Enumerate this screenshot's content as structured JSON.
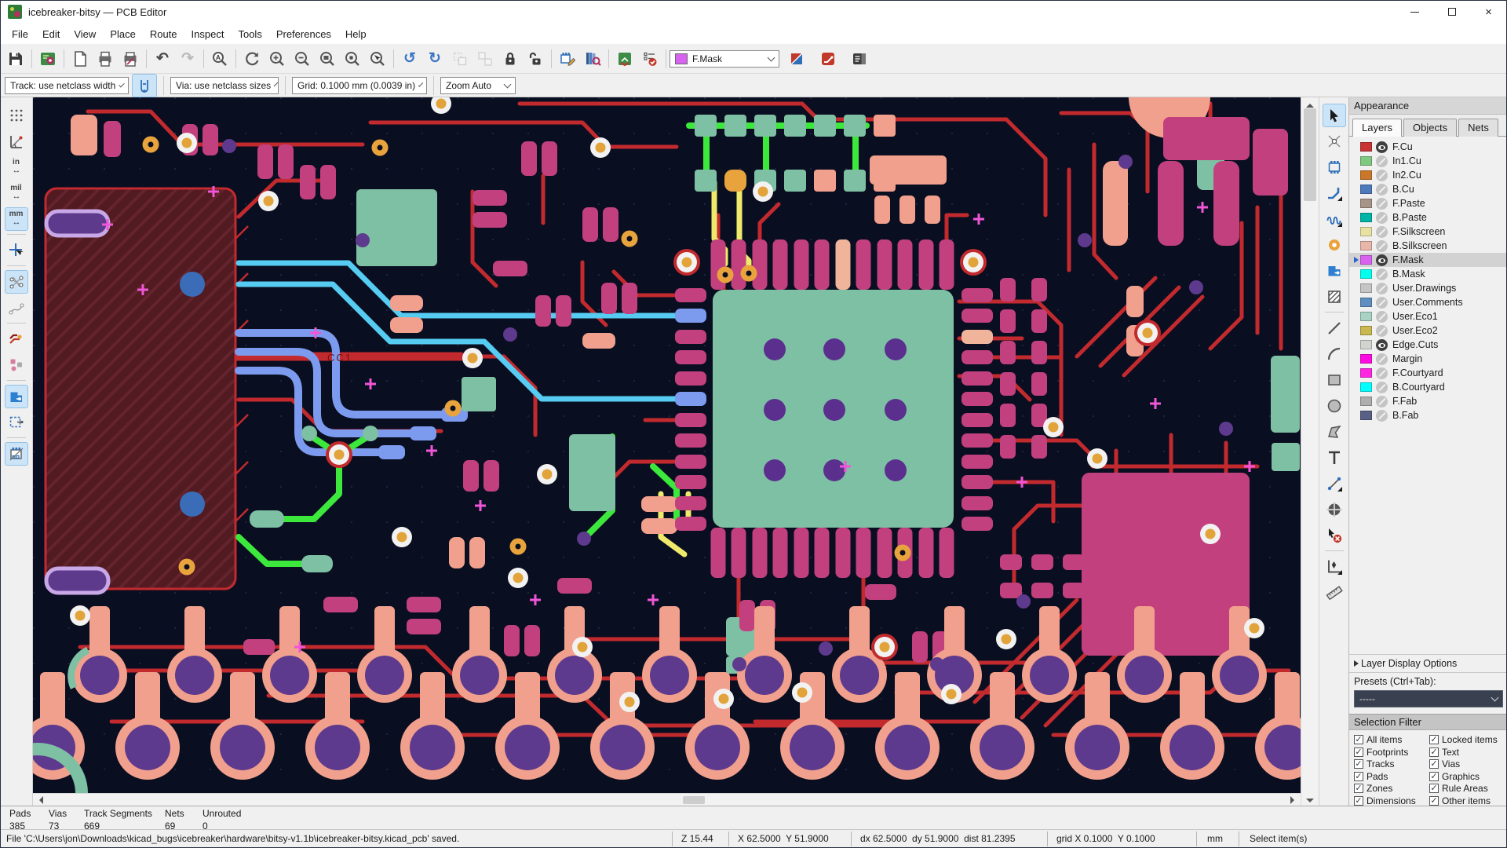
{
  "window": {
    "title": "icebreaker-bitsy — PCB Editor",
    "controls": [
      "minimize",
      "maximize",
      "close"
    ]
  },
  "menu": {
    "items": [
      "File",
      "Edit",
      "View",
      "Place",
      "Route",
      "Inspect",
      "Tools",
      "Preferences",
      "Help"
    ]
  },
  "toolbar": {
    "icons": [
      "save",
      "board-setup",
      "page-settings",
      "print",
      "plot",
      "undo",
      "redo",
      "find",
      "refresh-view",
      "zoom-in",
      "zoom-out",
      "zoom-fit",
      "zoom-objects",
      "zoom-selection",
      "rotate-ccw",
      "rotate-cw",
      "group",
      "ungroup",
      "lock",
      "unlock",
      "footprint-editor",
      "library-browser",
      "update-pcb",
      "design-rules-check",
      "layer-pair",
      "router-settings",
      "properties-panel"
    ],
    "active_layer": "F.Mask",
    "active_layer_color": "#d863f0"
  },
  "toolbar2": {
    "track": "Track: use netclass width",
    "via": "Via: use netclass sizes",
    "grid": "Grid: 0.1000 mm (0.0039 in)",
    "zoom": "Zoom Auto"
  },
  "left_toolbar": {
    "units_in": "in",
    "units_mil": "mil",
    "units_mm": "mm",
    "icons": [
      {
        "name": "toggle-grid",
        "active": false
      },
      {
        "name": "polar-coordinates",
        "active": false
      },
      {
        "name": "units-inches",
        "active": false
      },
      {
        "name": "units-mils",
        "active": false
      },
      {
        "name": "units-millimeters",
        "active": true
      },
      {
        "name": "crosshair-cursor",
        "active": false
      },
      {
        "name": "show-ratsnest",
        "active": true
      },
      {
        "name": "curved-ratsnest",
        "active": false
      },
      {
        "name": "track-display-mode",
        "active": false
      },
      {
        "name": "pad-display-mode",
        "active": false
      },
      {
        "name": "zone-display-mode",
        "active": true
      },
      {
        "name": "rule-area-display",
        "active": false
      },
      {
        "name": "footprint-display-mode",
        "active": true
      }
    ]
  },
  "right_toolbar": {
    "icons": [
      {
        "name": "select-tool",
        "active": true
      },
      {
        "name": "local-ratsnest",
        "active": false
      },
      {
        "name": "place-footprint",
        "active": false
      },
      {
        "name": "route-tracks",
        "active": false
      },
      {
        "name": "tune-length",
        "active": false
      },
      {
        "name": "place-via",
        "active": false
      },
      {
        "name": "add-zone",
        "active": false
      },
      {
        "name": "add-rule-area",
        "active": false
      },
      {
        "name": "draw-line",
        "active": false
      },
      {
        "name": "draw-arc",
        "active": false
      },
      {
        "name": "draw-rectangle",
        "active": false
      },
      {
        "name": "draw-circle",
        "active": false
      },
      {
        "name": "draw-polygon",
        "active": false
      },
      {
        "name": "add-text",
        "active": false
      },
      {
        "name": "add-dimension",
        "active": false
      },
      {
        "name": "add-target",
        "active": false
      },
      {
        "name": "delete-tool",
        "active": false
      },
      {
        "name": "set-origin",
        "active": false
      },
      {
        "name": "measure-tool",
        "active": false
      }
    ]
  },
  "appearance": {
    "title": "Appearance",
    "tabs": [
      "Layers",
      "Objects",
      "Nets"
    ],
    "active_tab": "Layers",
    "layers": [
      {
        "name": "F.Cu",
        "color": "#c83434",
        "visible": true,
        "selected": false
      },
      {
        "name": "In1.Cu",
        "color": "#7fc87f",
        "visible": false,
        "selected": false
      },
      {
        "name": "In2.Cu",
        "color": "#c87828",
        "visible": false,
        "selected": false
      },
      {
        "name": "B.Cu",
        "color": "#4e79bb",
        "visible": false,
        "selected": false
      },
      {
        "name": "F.Paste",
        "color": "#a79487",
        "visible": false,
        "selected": false
      },
      {
        "name": "B.Paste",
        "color": "#00b5a8",
        "visible": false,
        "selected": false
      },
      {
        "name": "F.Silkscreen",
        "color": "#e8e2a2",
        "visible": false,
        "selected": false
      },
      {
        "name": "B.Silkscreen",
        "color": "#e9b7a9",
        "visible": false,
        "selected": false
      },
      {
        "name": "F.Mask",
        "color": "#d863f0",
        "visible": true,
        "selected": true
      },
      {
        "name": "B.Mask",
        "color": "#02ffee",
        "visible": false,
        "selected": false
      },
      {
        "name": "User.Drawings",
        "color": "#c5c5c5",
        "visible": false,
        "selected": false
      },
      {
        "name": "User.Comments",
        "color": "#5e8fbe",
        "visible": false,
        "selected": false
      },
      {
        "name": "User.Eco1",
        "color": "#a8d2c3",
        "visible": false,
        "selected": false
      },
      {
        "name": "User.Eco2",
        "color": "#c9b851",
        "visible": false,
        "selected": false
      },
      {
        "name": "Edge.Cuts",
        "color": "#d2d4cf",
        "visible": true,
        "selected": false
      },
      {
        "name": "Margin",
        "color": "#ff0ce2",
        "visible": false,
        "selected": false
      },
      {
        "name": "F.Courtyard",
        "color": "#ff26e2",
        "visible": false,
        "selected": false
      },
      {
        "name": "B.Courtyard",
        "color": "#00ffff",
        "visible": false,
        "selected": false
      },
      {
        "name": "F.Fab",
        "color": "#aeaeae",
        "visible": false,
        "selected": false
      },
      {
        "name": "B.Fab",
        "color": "#5a5f85",
        "visible": false,
        "selected": false
      }
    ],
    "layer_display_options": "Layer Display Options",
    "presets_label": "Presets (Ctrl+Tab):",
    "presets_value": "-----"
  },
  "selection_filter": {
    "title": "Selection Filter",
    "items": [
      {
        "label": "All items",
        "checked": true
      },
      {
        "label": "Locked items",
        "checked": true
      },
      {
        "label": "Footprints",
        "checked": true
      },
      {
        "label": "Text",
        "checked": true
      },
      {
        "label": "Tracks",
        "checked": true
      },
      {
        "label": "Vias",
        "checked": true
      },
      {
        "label": "Pads",
        "checked": true
      },
      {
        "label": "Graphics",
        "checked": true
      },
      {
        "label": "Zones",
        "checked": true
      },
      {
        "label": "Rule Areas",
        "checked": true
      },
      {
        "label": "Dimensions",
        "checked": true
      },
      {
        "label": "Other items",
        "checked": true
      }
    ]
  },
  "status": {
    "cells": [
      {
        "label": "Pads",
        "value": "385"
      },
      {
        "label": "Vias",
        "value": "73"
      },
      {
        "label": "Track Segments",
        "value": "669"
      },
      {
        "label": "Nets",
        "value": "69"
      },
      {
        "label": "Unrouted",
        "value": "0"
      }
    ]
  },
  "statusbar": {
    "message": "File 'C:\\Users\\jon\\Downloads\\kicad_bugs\\icebreaker\\hardware\\bitsy-v1.1b\\icebreaker-bitsy.kicad_pcb' saved.",
    "zoom": "Z 15.44",
    "cursor": "X 62.5000  Y 51.9000",
    "delta": "dx 62.5000  dy 51.9000  dist 81.2395",
    "grid": "grid X 0.1000  Y 0.1000",
    "units": "mm",
    "hint": "Select item(s)"
  },
  "canvas": {
    "cc1_label": "CC1",
    "palette": {
      "background": "#0a0e21",
      "copper_red": "#c22a2e",
      "pad_magenta": "#c2407e",
      "pad_salmon": "#f0a08c",
      "component_teal": "#7ec0a4",
      "via_white": "#f2f2f2",
      "via_gold": "#e2a33a",
      "via_orange": "#e8a33d",
      "drill_purple": "#5e3a8e",
      "trace_cyan": "#56ccf2",
      "trace_blue": "#7c9bef",
      "trace_green": "#3ce83c",
      "trace_yellow": "#efe96c",
      "zone_dark_red": "#521a21",
      "mask_cross": "#f055d8",
      "hole_blue": "#3b6cb8"
    }
  }
}
